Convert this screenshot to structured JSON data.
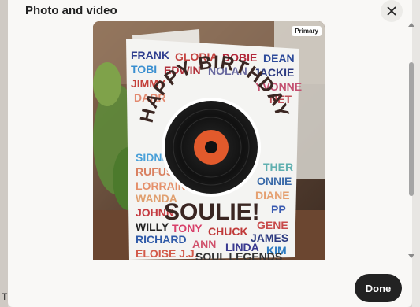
{
  "modal": {
    "title": "Photo and video",
    "close_icon": "close-icon",
    "done_label": "Done"
  },
  "photo": {
    "badge": "Primary",
    "description_icon": "photo",
    "card_headline": "HAPPY BIRTHDAY",
    "card_name": "SOULIE!",
    "card_names": [
      "FRANK",
      "GLORIA",
      "DOBIE",
      "DEAN",
      "TOBI",
      "EDWIN",
      "NOLAN",
      "JACKIE",
      "JIMMY",
      "YVONNE",
      "RUFUS",
      "LORRAINE",
      "WANDA",
      "JOHNNY",
      "WILLY",
      "TONY",
      "CHUCK",
      "JAMES",
      "RICHARD",
      "ANN",
      "LINDA",
      "KIM",
      "ELOISE J.J.",
      "SOUL LEGENDS",
      "GENE",
      "PP",
      "DIANE",
      "CONNIE",
      "SIDNEY",
      "HER"
    ]
  },
  "background": {
    "left_fragment": "T"
  }
}
